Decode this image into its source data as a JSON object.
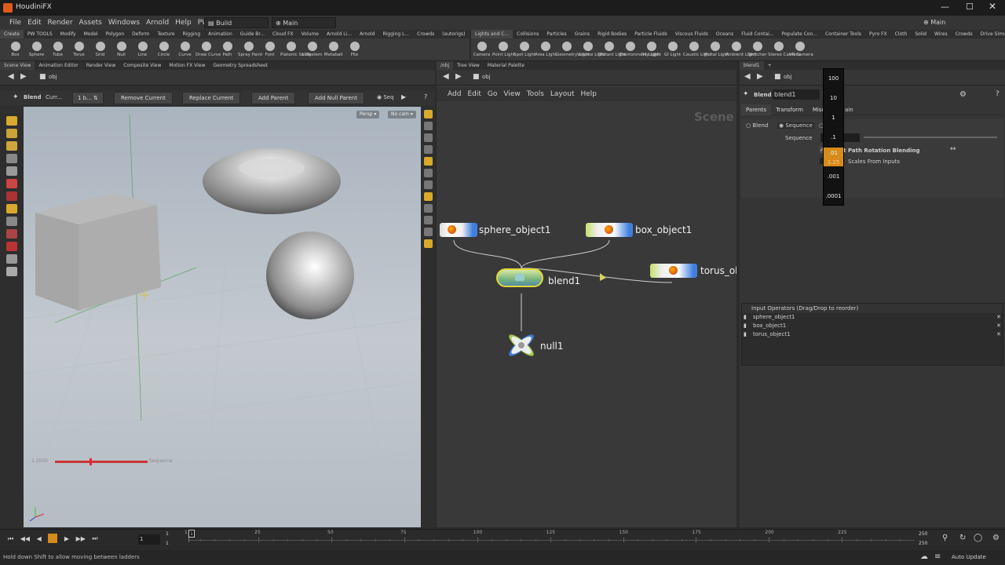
{
  "app": {
    "title": "HoudiniFX",
    "desktop_label": "Build",
    "main_desk": "Main",
    "main_right": "Main"
  },
  "menus": [
    "File",
    "Edit",
    "Render",
    "Assets",
    "Windows",
    "Arnold",
    "Help",
    "PW_Tools"
  ],
  "shelf_left": {
    "tabs": [
      "Create",
      "PW TOOLS",
      "Modify",
      "Model",
      "Polygon",
      "Deform",
      "Texture",
      "Rigging",
      "Animation",
      "Guide Br...",
      "Cloud FX",
      "Volume",
      "Arnold Li...",
      "Arnold",
      "Rigging L...",
      "Crowds",
      "(autorigs)"
    ],
    "tools": [
      "Box",
      "Sphere",
      "Tube",
      "Torus",
      "Grid",
      "Null",
      "Line",
      "Circle",
      "Curve",
      "Draw Curve",
      "Path",
      "Spray Paint",
      "Font",
      "Platonic Solids",
      "L-System",
      "Metaball",
      "File"
    ]
  },
  "shelf_right": {
    "tabs": [
      "Lights and C...",
      "Collisions",
      "Particles",
      "Grains",
      "Rigid Bodies",
      "Particle Fluids",
      "Viscous Fluids",
      "Oceans",
      "Fluid Contai...",
      "Populate Con...",
      "Container Tools",
      "Pyro FX",
      "Cloth",
      "Solid",
      "Wires",
      "Crowds",
      "Drive Simula..."
    ],
    "tools": [
      "Camera",
      "Point Light",
      "Spot Light",
      "Area Light",
      "Geometry Light",
      "Volume Light",
      "Distant Light",
      "Environment Light",
      "Sky Light",
      "GI Light",
      "Caustic Light",
      "Portal Light",
      "Ambient Light",
      "Switcher",
      "Stereo Camera",
      "VR Camera"
    ]
  },
  "viewer": {
    "tabs": [
      "Scene View",
      "Animation Editor",
      "Render View",
      "Composite View",
      "Motion FX View",
      "Geometry Spreadsheet"
    ],
    "path": "obj",
    "tool_name": "Blend",
    "curr": "Curr...",
    "one_b": "1 b...",
    "buttons": [
      "Remove Current",
      "Replace Current",
      "Add Parent",
      "Add Null Parent"
    ],
    "seq": "Seq",
    "persp": "Persp",
    "nocam": "No cam",
    "slider_left": "1.2500",
    "slider_right": "Sequence",
    "slider_fraction": 0.37
  },
  "network": {
    "tabs": [
      "/obj",
      "Tree View",
      "Material Palette"
    ],
    "path": "obj",
    "menu": [
      "Add",
      "Edit",
      "Go",
      "View",
      "Tools",
      "Layout",
      "Help"
    ],
    "watermark": "Scene",
    "nodes": {
      "sphere": "sphere_object1",
      "box": "box_object1",
      "torus": "torus_ob",
      "blend": "blend1",
      "null": "null1"
    }
  },
  "params": {
    "tabs": [
      "blend1"
    ],
    "path": "obj",
    "node_type": "Blend",
    "node_name": "blend1",
    "ptabs": [
      "Parents",
      "Transform",
      "Misc"
    ],
    "ptab_extra": "ain",
    "radio": [
      "Blend",
      "Sequence"
    ],
    "sequence_label": "Sequence",
    "sequence_value": "1",
    "check1": "st Path Rotation Blending",
    "check2": "Scales From Inputs",
    "ladder": [
      "100",
      "10",
      "1",
      ".1",
      ".01",
      ".001",
      ".0001"
    ],
    "ladder_sub": "1.25",
    "input_ops_title": "Input Operators (Drag/Drop to reorder)",
    "input_ops": [
      "sphere_object1",
      "box_object1",
      "torus_object1"
    ]
  },
  "timeline": {
    "frame": "1",
    "start": "1",
    "start2": "1",
    "end": "250",
    "end2": "250",
    "ticks": [
      "1",
      "25",
      "50",
      "75",
      "100",
      "125",
      "150",
      "175",
      "200",
      "225"
    ]
  },
  "status": {
    "message": "Hold down Shift to allow moving between ladders",
    "auto_update": "Auto Update"
  }
}
